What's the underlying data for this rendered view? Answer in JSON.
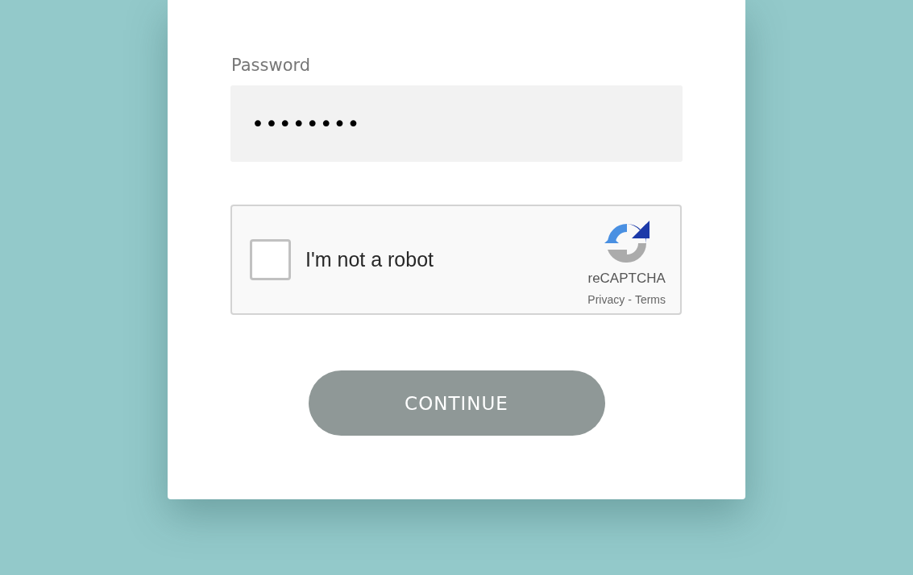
{
  "password": {
    "label": "Password",
    "value": "••••••••"
  },
  "captcha": {
    "label": "I'm not a robot",
    "checked": false,
    "brand": "reCAPTCHA",
    "privacy_link": "Privacy",
    "separator": "-",
    "terms_link": "Terms"
  },
  "continue_button": {
    "label": "CONTINUE"
  }
}
